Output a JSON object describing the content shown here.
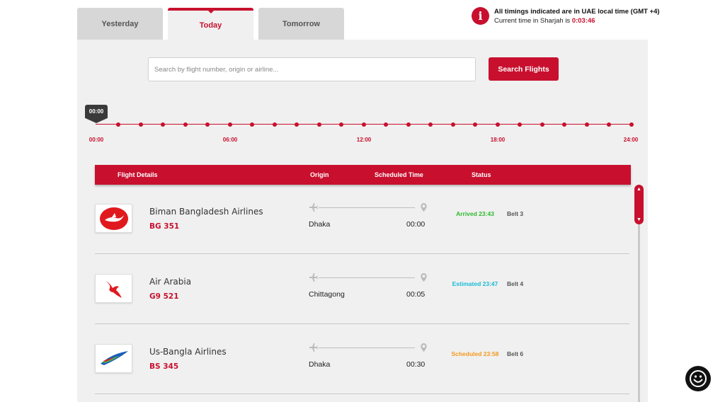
{
  "tabs": [
    {
      "label": "Yesterday",
      "active": false
    },
    {
      "label": "Today",
      "active": true
    },
    {
      "label": "Tomorrow",
      "active": false
    }
  ],
  "info": {
    "icon": "info-icon",
    "title": "All timings indicated are in UAE local time (GMT +4)",
    "current_prefix": "Current time in Sharjah is ",
    "current_time": "0:03:46"
  },
  "search": {
    "placeholder": "Search by flight number, origin or airline...",
    "value": "",
    "button_label": "Search Flights"
  },
  "timeline": {
    "handle_label": "00:00",
    "labels": [
      "00:00",
      "06:00",
      "12:00",
      "18:00",
      "24:00"
    ]
  },
  "table": {
    "headers": {
      "flight_details": "Flight Details",
      "origin": "Origin",
      "scheduled_time": "Scheduled Time",
      "status": "Status"
    },
    "rows": [
      {
        "airline": "Biman Bangladesh Airlines",
        "flight_no": "BG 351",
        "origin": "Dhaka",
        "scheduled": "00:00",
        "status": "Arrived 23:43",
        "status_color": "#2eb82e",
        "belt": "Belt 3",
        "logo": "biman-logo-icon"
      },
      {
        "airline": "Air Arabia",
        "flight_no": "G9 521",
        "origin": "Chittagong",
        "scheduled": "00:05",
        "status": "Estimated 23:47",
        "status_color": "#17bcd4",
        "belt": "Belt 4",
        "logo": "air-arabia-logo-icon"
      },
      {
        "airline": "Us-Bangla Airlines",
        "flight_no": "BS 345",
        "origin": "Dhaka",
        "scheduled": "00:30",
        "status": "Scheduled 23:58",
        "status_color": "#f39a1c",
        "belt": "Belt 6",
        "logo": "us-bangla-logo-icon"
      }
    ]
  },
  "colors": {
    "accent": "#c8102e",
    "panel": "#f0f0f0",
    "tab_inactive": "#d7d7d7"
  }
}
